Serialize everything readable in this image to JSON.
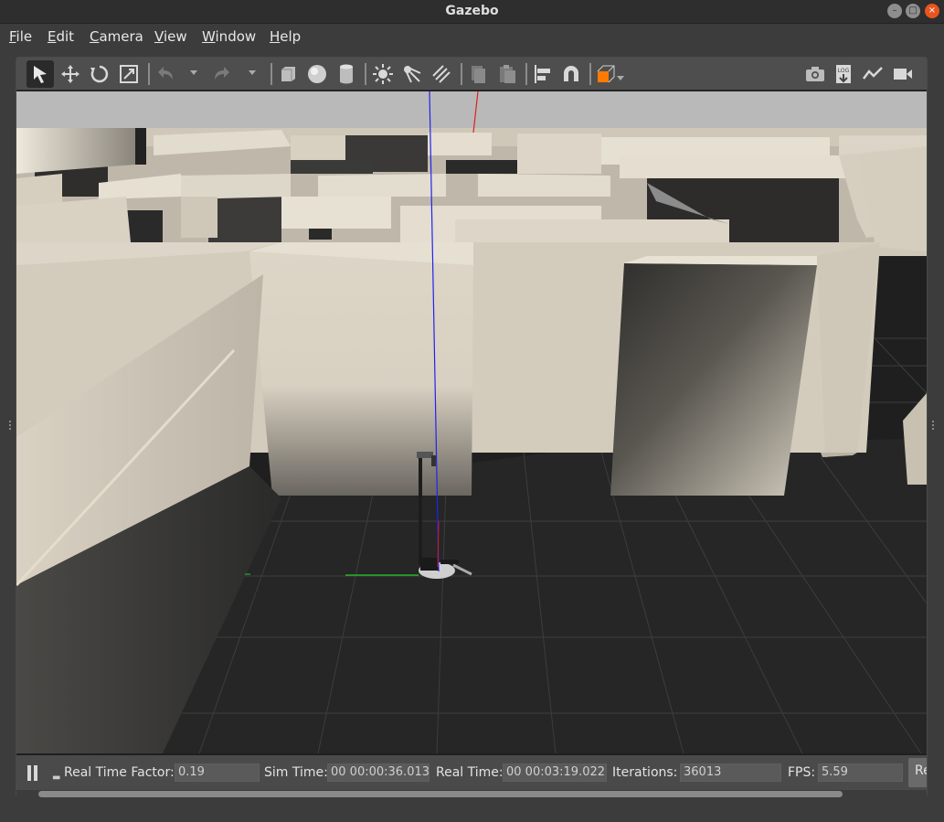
{
  "window": {
    "title": "Gazebo"
  },
  "menu": [
    {
      "first": "F",
      "rest": "ile"
    },
    {
      "first": "E",
      "rest": "dit"
    },
    {
      "first": "C",
      "rest": "amera"
    },
    {
      "first": "V",
      "rest": "iew"
    },
    {
      "first": "W",
      "rest": "indow"
    },
    {
      "first": "H",
      "rest": "elp"
    }
  ],
  "toolbar": {
    "tools": [
      "select-mode-icon",
      "translate-mode-icon",
      "rotate-mode-icon",
      "scale-mode-icon",
      "undo-icon",
      "redo-icon",
      "box-shape-icon",
      "sphere-shape-icon",
      "cylinder-shape-icon",
      "point-light-icon",
      "spot-light-icon",
      "directional-light-icon",
      "copy-icon",
      "paste-icon",
      "align-icon",
      "snap-icon",
      "view-angle-icon",
      "screenshot-icon",
      "log-icon",
      "plot-icon",
      "video-record-icon"
    ],
    "log_label": "LOG"
  },
  "status": {
    "real_time_factor_label": "Real Time Factor:",
    "real_time_factor": "0.19",
    "sim_time_label": "Sim Time:",
    "sim_time": "00 00:00:36.013",
    "real_time_label": "Real Time:",
    "real_time": "00 00:03:19.022",
    "iterations_label": "Iterations:",
    "iterations": "36013",
    "fps_label": "FPS:",
    "fps": "5.59",
    "reset_label": "Reset"
  },
  "colors": {
    "accent": "#e95420",
    "sky": "#b9b9b9",
    "wall": "#d8d1c3",
    "ground": "#262626",
    "axis_x": "#d02020",
    "axis_y": "#20c020",
    "axis_z": "#2020e0"
  }
}
